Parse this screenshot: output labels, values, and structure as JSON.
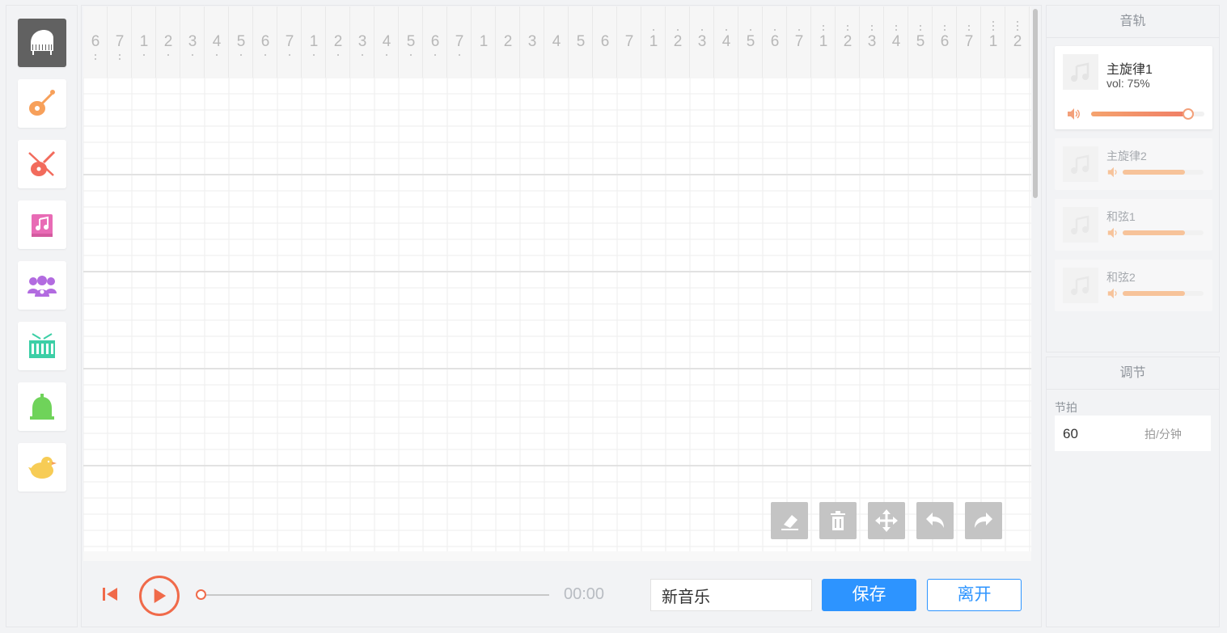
{
  "sidebar": {
    "instruments": [
      {
        "name": "piano",
        "icon": "piano-icon",
        "active": true
      },
      {
        "name": "guitar",
        "icon": "guitar-icon",
        "color": "#f7a05a"
      },
      {
        "name": "violin",
        "icon": "violin-icon",
        "color": "#f26b5c"
      },
      {
        "name": "music-book",
        "icon": "music-book-icon",
        "color": "#e86bb5"
      },
      {
        "name": "choir",
        "icon": "choir-icon",
        "color": "#b26be0"
      },
      {
        "name": "drum",
        "icon": "drum-icon",
        "color": "#3ccfa6"
      },
      {
        "name": "bell",
        "icon": "bell-icon",
        "color": "#6fd35a"
      },
      {
        "name": "bird",
        "icon": "bird-icon",
        "color": "#f7cc55"
      }
    ]
  },
  "ruler": {
    "labels": [
      "6",
      "7",
      "1",
      "2",
      "3",
      "4",
      "5",
      "6",
      "7",
      "1",
      "2",
      "3",
      "4",
      "5",
      "6",
      "7",
      "1",
      "2",
      "3",
      "4",
      "5",
      "6",
      "7",
      "1",
      "2",
      "3",
      "4",
      "5",
      "6",
      "7",
      "1",
      "2",
      "3",
      "4",
      "5",
      "6",
      "7",
      "1",
      "2"
    ],
    "octave_marks": [
      -2,
      -2,
      -1,
      -1,
      -1,
      -1,
      -1,
      -1,
      -1,
      -1,
      -1,
      -1,
      -1,
      -1,
      -1,
      -1,
      0,
      0,
      0,
      0,
      0,
      0,
      0,
      1,
      1,
      1,
      1,
      1,
      1,
      1,
      2,
      2,
      2,
      2,
      2,
      2,
      2,
      3,
      3
    ]
  },
  "tools": {
    "eraser": "eraser-icon",
    "delete": "trash-icon",
    "move": "move-icon",
    "undo": "undo-icon",
    "redo": "redo-icon"
  },
  "transport": {
    "time": "00:00",
    "progress": 0,
    "name_value": "新音乐",
    "save_label": "保存",
    "leave_label": "离开"
  },
  "tracks_panel": {
    "title": "音轨",
    "tracks": [
      {
        "name": "主旋律1",
        "vol_text": "vol: 75%",
        "volume": 0.86,
        "active": true
      },
      {
        "name": "主旋律2",
        "volume": 0.77,
        "active": false
      },
      {
        "name": "和弦1",
        "volume": 0.77,
        "active": false
      },
      {
        "name": "和弦2",
        "volume": 0.77,
        "active": false
      }
    ]
  },
  "adjust_panel": {
    "title": "调节",
    "tempo_label": "节拍",
    "tempo_value": "60",
    "tempo_unit": "拍/分钟"
  },
  "colors": {
    "accent": "#f06a4a",
    "primary": "#2d94ff",
    "volume_fill": "#f3a07a"
  }
}
